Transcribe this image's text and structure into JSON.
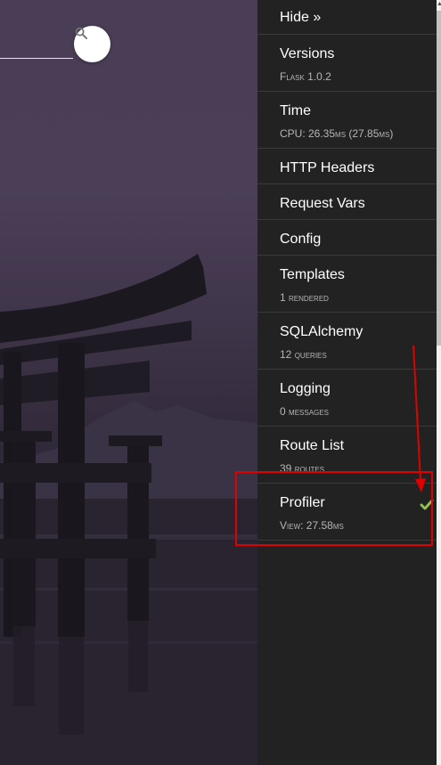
{
  "search": {
    "icon": "search-icon"
  },
  "toolbar": {
    "hide_label": "Hide »"
  },
  "panels": [
    {
      "title": "Versions",
      "sub_prefix": "Flask",
      "sub_value": "1.0.2"
    },
    {
      "title": "Time",
      "sub_cpu": "CPU: 26.35",
      "sub_unit1": "ms",
      "sub_mid": " (27.85",
      "sub_unit2": "ms",
      "sub_end": ")"
    },
    {
      "title": "HTTP Headers"
    },
    {
      "title": "Request Vars"
    },
    {
      "title": "Config"
    },
    {
      "title": "Templates",
      "sub_num": "1",
      "sub_word": "rendered"
    },
    {
      "title": "SQLAlchemy",
      "sub_num": "12",
      "sub_word": "queries"
    },
    {
      "title": "Logging",
      "sub_num": "0",
      "sub_word": "messages"
    },
    {
      "title": "Route List",
      "sub_num": "39",
      "sub_word": "routes"
    },
    {
      "title": "Profiler",
      "sub_prefix": "View",
      "sub_value": ": 27.58",
      "sub_unit": "ms",
      "enabled": true
    }
  ],
  "colors": {
    "panel_bg": "#222222",
    "annotation": "#e00000",
    "check": "#8fbf4f"
  }
}
